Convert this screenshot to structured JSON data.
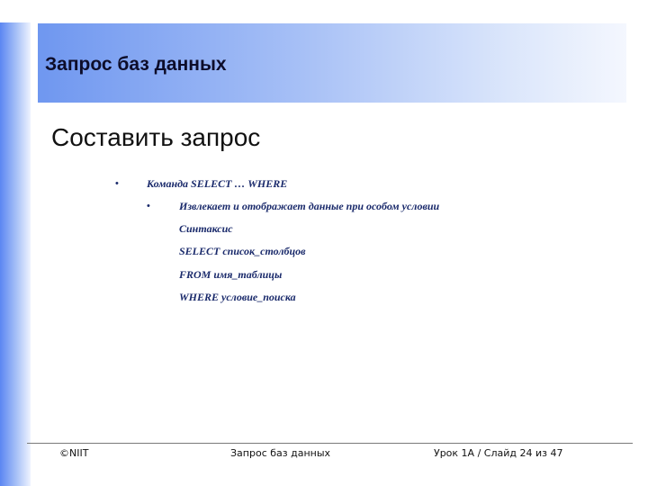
{
  "header": {
    "title": "Запрос баз данных"
  },
  "slide": {
    "heading": "Составить запрос",
    "bullet_1": "Команда SELECT … WHERE",
    "bullet_2": "Извлекает и отображает данные при особом условии",
    "syntax_label": "Синтаксис",
    "syntax_select": "SELECT список_столбцов",
    "syntax_from": "FROM имя_таблицы",
    "syntax_where": "WHERE условие_поиска"
  },
  "footer": {
    "copyright": "©NIIT",
    "center": "Запрос баз данных",
    "slide_info": "Урок 1A / Слайд 24 из 47"
  },
  "colors": {
    "accent_blue": "#5b86f2",
    "text_navy": "#1a2a6b"
  }
}
